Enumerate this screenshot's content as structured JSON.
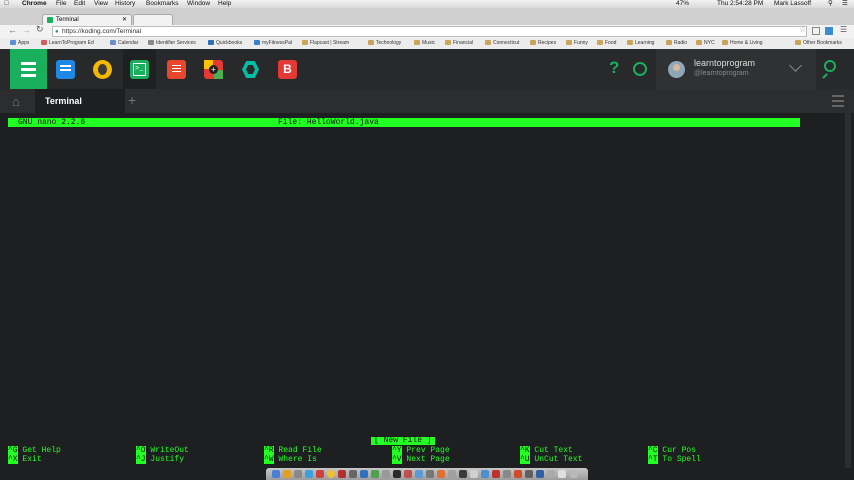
{
  "menubar": {
    "apple": "",
    "items": [
      "Chrome",
      "File",
      "Edit",
      "View",
      "History",
      "Bookmarks",
      "Window",
      "Help"
    ],
    "battery": "47%",
    "clock": "Thu 2:54:28 PM",
    "user": "Mark Lassoff"
  },
  "browser": {
    "tab_title": "Terminal",
    "url": "https://koding.com/Terminal",
    "bookmarks": [
      "Apps",
      "LearnToProgram Ed",
      "Calendar",
      "Identifier Services",
      "Quickbooks",
      "myFitnessPal",
      "Flapcast | Stream",
      "Technology",
      "Music",
      "Financial",
      "Connecticut",
      "Recipes",
      "Funny",
      "Food",
      "Learning",
      "Radio",
      "NYC",
      "Home & Living"
    ],
    "other_bookmarks": "Other Bookmarks"
  },
  "koding": {
    "user_name": "learntoprogram",
    "user_handle": "@learntoprogram",
    "help_glyph": "?",
    "tab_label": "Terminal",
    "add_tab": "+",
    "colors": {
      "brand": "#1aaf5d",
      "bar": "#27292b"
    }
  },
  "nano": {
    "version": "GNU nano 2.2.6",
    "file_label": "File: HelloWorld.java",
    "status": "[ New File ]",
    "shortcuts_row1": [
      {
        "key": "^G",
        "label": "Get Help"
      },
      {
        "key": "^O",
        "label": "WriteOut"
      },
      {
        "key": "^R",
        "label": "Read File"
      },
      {
        "key": "^Y",
        "label": "Prev Page"
      },
      {
        "key": "^K",
        "label": "Cut Text"
      },
      {
        "key": "^C",
        "label": "Cur Pos"
      }
    ],
    "shortcuts_row2": [
      {
        "key": "^X",
        "label": "Exit"
      },
      {
        "key": "^J",
        "label": "Justify"
      },
      {
        "key": "^W",
        "label": "Where Is"
      },
      {
        "key": "^V",
        "label": "Next Page"
      },
      {
        "key": "^U",
        "label": "UnCut Text"
      },
      {
        "key": "^T",
        "label": "To Spell"
      }
    ],
    "colors": {
      "highlight": "#22ff22",
      "background": "#1d1f21"
    }
  }
}
